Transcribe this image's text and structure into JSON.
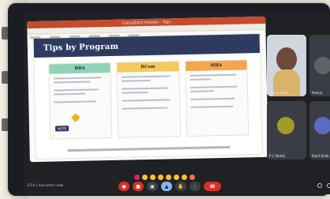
{
  "meeting": {
    "time": "3:14",
    "meeting_code": "xvn-pmrc-uob",
    "info_line": "3:14  |  xvn-pmrc-uob"
  },
  "powerpoint": {
    "document_title": "Consultant Interim - Tips"
  },
  "slide": {
    "title": "Tips by Program",
    "columns": [
      {
        "heading": "BBA",
        "color": "#8fd3b6"
      },
      {
        "heading": "BCom",
        "color": "#f4c95d"
      },
      {
        "heading": "MBA",
        "color": "#f3a64b"
      }
    ],
    "tag_label": "NOTE"
  },
  "participants": [
    {
      "name": "Meera Joshi",
      "label": "Meera Joshi"
    },
    {
      "name": "Pankaj",
      "label": "Pankaj"
    },
    {
      "name": "P C Mehta",
      "label": "P C Mehta"
    },
    {
      "name": "Rohit Shah",
      "label": "Rohit Shah"
    }
  ],
  "controls": [
    {
      "name": "mic",
      "icon": "mic-icon",
      "state": "muted"
    },
    {
      "name": "camera",
      "icon": "camera-icon",
      "state": "off"
    },
    {
      "name": "captions",
      "icon": "cc-icon",
      "state": "off"
    },
    {
      "name": "present",
      "icon": "present-icon",
      "state": "on"
    },
    {
      "name": "raise-hand",
      "icon": "hand-icon",
      "state": "off"
    },
    {
      "name": "more",
      "icon": "more-icon",
      "state": "off"
    },
    {
      "name": "end-call",
      "icon": "end-call-icon",
      "state": "active"
    }
  ],
  "accent_colors": {
    "header": "#2e3b5e",
    "ppt": "#c54b2c",
    "end_call": "#d93025"
  }
}
